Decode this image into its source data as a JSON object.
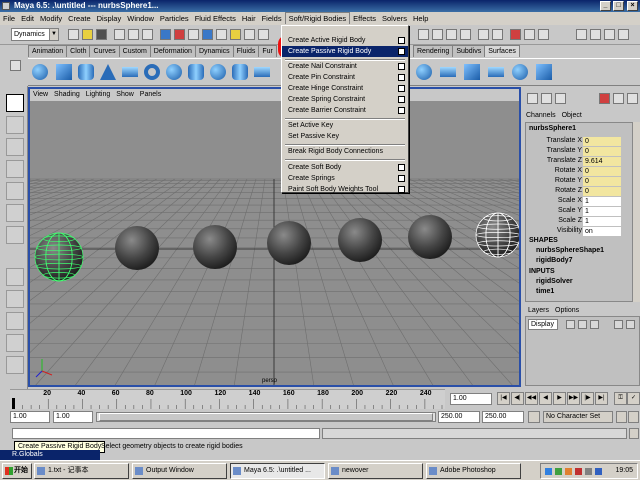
{
  "window": {
    "title": "Maya 6.5: .\\untitled  ---  nurbsSphere1..."
  },
  "menubar": {
    "items": [
      "File",
      "Edit",
      "Modify",
      "Create",
      "Display",
      "Window",
      "Particles",
      "Fluid Effects",
      "Hair",
      "Fields",
      "Soft/Rigid Bodies",
      "Effects",
      "Solvers",
      "Help"
    ]
  },
  "statusline": {
    "mode": "Dynamics"
  },
  "shelf": {
    "tabs_left": [
      "Animation",
      "Cloth",
      "Curves",
      "Custom",
      "Deformation",
      "Dynamics",
      "Fluids",
      "Fur"
    ],
    "tabs_right": [
      "Rendering",
      "Subdivs",
      "Surfaces"
    ]
  },
  "viewport": {
    "menu": [
      "View",
      "Shading",
      "Lighting",
      "Show",
      "Panels"
    ],
    "camera_label": "persp"
  },
  "dropdown": {
    "items": [
      {
        "label": "Create Active Rigid Body",
        "option": true
      },
      {
        "label": "Create Passive Rigid Body",
        "option": true
      },
      {
        "label": "Create Nail Constraint",
        "option": true
      },
      {
        "label": "Create Pin Constraint",
        "option": true
      },
      {
        "label": "Create Hinge Constraint",
        "option": true
      },
      {
        "label": "Create Spring Constraint",
        "option": true
      },
      {
        "label": "Create Barrier Constraint",
        "option": true
      },
      {
        "label": "Set Active Key",
        "option": false
      },
      {
        "label": "Set Passive Key",
        "option": false
      },
      {
        "label": "Break Rigid Body Connections",
        "option": false
      },
      {
        "label": "Create Soft Body",
        "option": true
      },
      {
        "label": "Create Springs",
        "option": true
      },
      {
        "label": "Paint Soft Body Weights Tool",
        "option": true
      }
    ],
    "highlighted": "Create Passive Rigid Body"
  },
  "channelbox": {
    "menu": [
      "Channels",
      "Object"
    ],
    "object": "nurbsSphere1",
    "channels": [
      {
        "label": "Translate X",
        "value": "0"
      },
      {
        "label": "Translate Y",
        "value": "0"
      },
      {
        "label": "Translate Z",
        "value": "9.614"
      },
      {
        "label": "Rotate X",
        "value": "0"
      },
      {
        "label": "Rotate Y",
        "value": "0"
      },
      {
        "label": "Rotate Z",
        "value": "0"
      },
      {
        "label": "Scale X",
        "value": "1"
      },
      {
        "label": "Scale Y",
        "value": "1"
      },
      {
        "label": "Scale Z",
        "value": "1"
      },
      {
        "label": "Visibility",
        "value": "on"
      }
    ],
    "shapes_header": "SHAPES",
    "shapes": [
      "nurbsSphereShape1",
      "rigidBody7"
    ],
    "inputs_header": "INPUTS",
    "inputs": [
      "rigidSolver",
      "time1"
    ]
  },
  "layers": {
    "menu": [
      "Layers",
      "Options"
    ],
    "display": "Display"
  },
  "timeslider": {
    "ticks": [
      "20",
      "40",
      "60",
      "80",
      "100",
      "120",
      "140",
      "160",
      "180",
      "200",
      "220",
      "240"
    ],
    "current_frame": "1.00"
  },
  "range": {
    "start": "1.00",
    "min": "1.00",
    "end": "250.00",
    "max": "250.00",
    "character_set": "No Character Set"
  },
  "helpline": {
    "tooltip": "Create Passive Rigid Body",
    "message": "Select geometry objects to create rigid bodies"
  },
  "rglobals": "R.Globals",
  "taskbar": {
    "start": "开始",
    "tasks": [
      "1.txt - 记事本",
      "Output Window",
      "Maya 6.5: .\\untitled ...",
      "newover",
      "Adobe Photoshop"
    ],
    "clock": "19:05"
  },
  "colors": {
    "highlight": "#0a246a",
    "redmark": "#ee1111",
    "viewport_bg": "#8e8e8e",
    "viewport_border": "#2a4fa8"
  }
}
